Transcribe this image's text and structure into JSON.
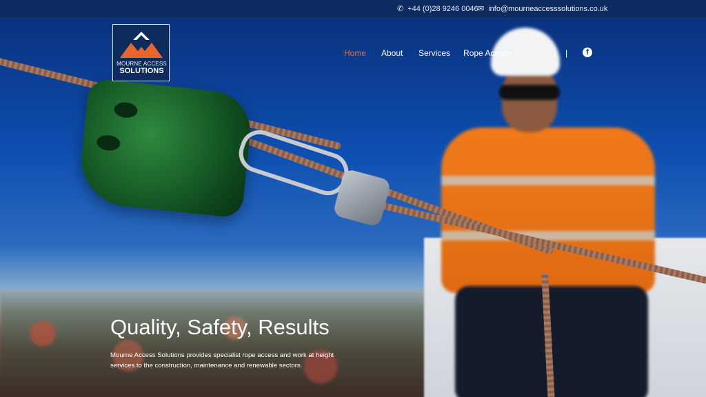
{
  "topbar": {
    "phone": "+44 (0)28 9246 0046",
    "email": "info@mourneaccesssolutions.co.uk",
    "phone_icon": "phone-icon",
    "email_icon": "envelope-icon"
  },
  "logo": {
    "line1": "MOURNE ACCESS",
    "line2": "SOLUTIONS",
    "accent": "#e8652e"
  },
  "nav": {
    "items": [
      "Home",
      "About",
      "Services",
      "Rope Access"
    ],
    "active_color": "#e26b3b",
    "separator": "|",
    "social_icon": "facebook-icon"
  },
  "hero": {
    "title": "Quality, Safety, Results",
    "text": "Mourne Access Solutions provides specialist rope access and work at height services to the construction, maintenance and renewable sectors."
  }
}
